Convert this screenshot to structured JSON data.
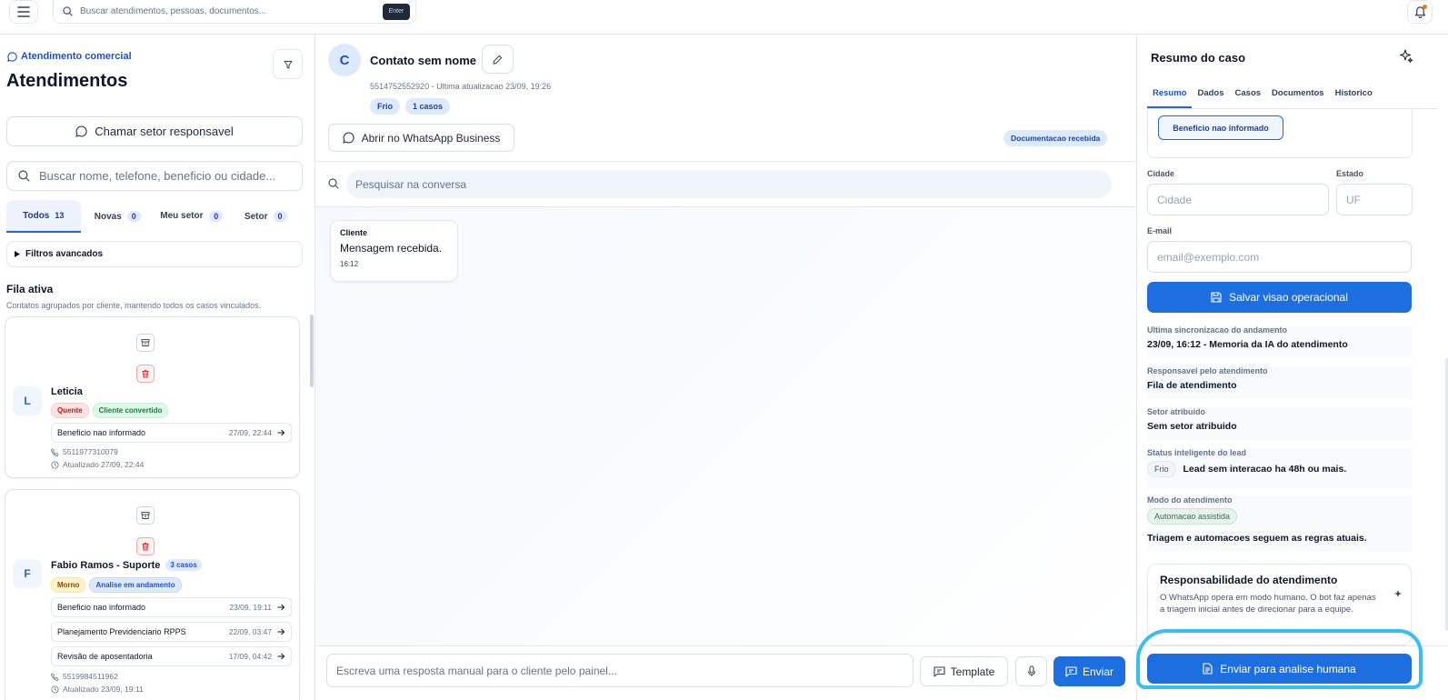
{
  "topbar": {
    "search_placeholder": "Buscar atendimentos, pessoas, documentos...",
    "enter_label": "Enter"
  },
  "left": {
    "breadcrumb": "Atendimento comercial",
    "title": "Atendimentos",
    "call_button": "Chamar setor responsavel",
    "search_placeholder": "Buscar nome, telefone, beneficio ou cidade...",
    "tabs": [
      {
        "label": "Todos",
        "count": "13"
      },
      {
        "label": "Novas",
        "count": "0"
      },
      {
        "label": "Meu setor",
        "count": "0"
      },
      {
        "label": "Setor",
        "count": "0"
      }
    ],
    "advanced_filters": "Filtros avancados",
    "queue_title": "Fila ativa",
    "queue_subtitle": "Contatos agrupados por cliente, mantendo todos os casos vinculados.",
    "cards": [
      {
        "initial": "L",
        "name": "Leticia",
        "badges": [
          "Quente",
          "Cliente convertido"
        ],
        "cases": [
          {
            "name": "Beneficio nao informado",
            "date": "27/09, 22:44"
          }
        ],
        "phone": "5511977310079",
        "updated": "Atualizado 27/09, 22:44"
      },
      {
        "initial": "F",
        "name": "Fabio Ramos - Suporte",
        "case_count": "3 casos",
        "badges": [
          "Morno",
          "Analise em andamento"
        ],
        "cases": [
          {
            "name": "Beneficio nao informado",
            "date": "23/09, 19:11"
          },
          {
            "name": "Planejamento Previdenciario RPPS",
            "date": "22/09, 03:47"
          },
          {
            "name": "Revisão de aposentadoria",
            "date": "17/09, 04:42"
          }
        ],
        "phone": "5519984511962",
        "updated": "Atualizado 23/09, 19:11"
      }
    ]
  },
  "center": {
    "avatar_initial": "C",
    "contact_name": "Contato sem nome",
    "contact_meta": "5514752552920 - Ultima atualizacao 23/09, 19:26",
    "pills": [
      "Frio",
      "1 casos"
    ],
    "whatsapp_button": "Abrir no WhatsApp Business",
    "doc_badge": "Documentacao recebida",
    "conversation_search_placeholder": "Pesquisar na conversa",
    "messages": [
      {
        "sender": "Cliente",
        "text": "Mensagem recebida.",
        "time": "16:12"
      }
    ],
    "reply_placeholder": "Escreva uma resposta manual para o cliente pelo painel...",
    "template_button": "Template",
    "send_button": "Enviar"
  },
  "right": {
    "title": "Resumo do caso",
    "tabs": [
      "Resumo",
      "Dados",
      "Casos",
      "Documentos",
      "Historico"
    ],
    "benefit_button": "Beneficio nao informado",
    "city_label": "Cidade",
    "city_placeholder": "Cidade",
    "state_label": "Estado",
    "state_placeholder": "UF",
    "email_label": "E-mail",
    "email_placeholder": "email@exemplo.com",
    "save_button": "Salvar visao operacional",
    "sync_label": "Ultima sincronizacao do andamento",
    "sync_value": "23/09, 16:12 - Memoria da IA do atendimento",
    "responsible_label": "Responsavel pelo atendimento",
    "responsible_value": "Fila de atendimento",
    "sector_label": "Setor atribuido",
    "sector_value": "Sem setor atribuido",
    "lead_status_label": "Status inteligente do lead",
    "lead_status_pill": "Frio",
    "lead_status_value": "Lead sem interacao ha 48h ou mais.",
    "mode_label": "Modo do atendimento",
    "mode_pill": "Automacao assistida",
    "mode_value": "Triagem e automacoes seguem as regras atuais.",
    "resp_title": "Responsabilidade do atendimento",
    "resp_desc": "O WhatsApp opera em modo humano. O bot faz apenas a triagem inicial antes de direcionar para a equipe.",
    "human_button": "Enviar para analise humana"
  },
  "colors": {
    "primary": "#1d6fe0",
    "highlight": "#38bdf8"
  }
}
